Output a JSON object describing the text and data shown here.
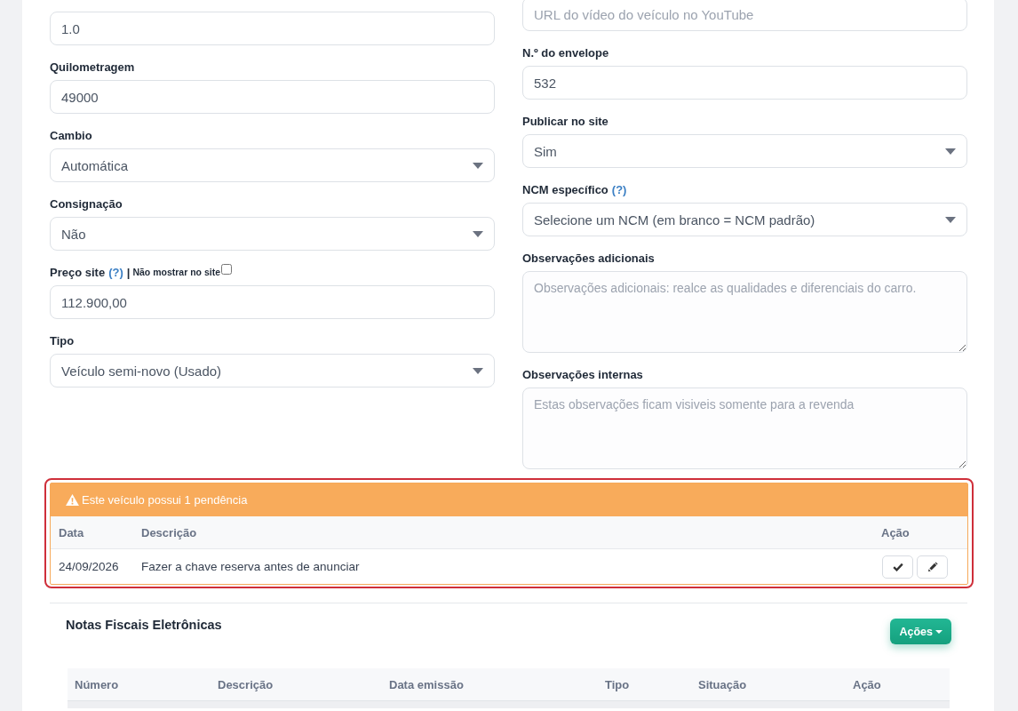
{
  "form": {
    "left_column": [
      {
        "kind": "input",
        "value": "1.0"
      },
      {
        "label": "Quilometragem",
        "kind": "input",
        "value": "49000"
      },
      {
        "label": "Cambio",
        "kind": "select",
        "value": "Automática"
      },
      {
        "label": "Consignação",
        "kind": "select",
        "value": "Não"
      },
      {
        "label": "Preço site",
        "help": "(?)",
        "separator": "|",
        "option": {
          "label": "Não mostrar no site",
          "checked": false
        },
        "kind": "input",
        "value": "112.900,00"
      },
      {
        "label": "Tipo",
        "kind": "select",
        "value": "Veículo semi-novo (Usado)"
      }
    ],
    "right_column": [
      {
        "kind": "input",
        "placeholder": "URL do vídeo do veículo no YouTube"
      },
      {
        "label": "N.º do envelope",
        "kind": "input",
        "value": "532"
      },
      {
        "label": "Publicar no site",
        "kind": "select",
        "value": "Sim"
      },
      {
        "label": "NCM específico",
        "help": "(?)",
        "kind": "select",
        "value": "Selecione um NCM (em branco = NCM padrão)"
      },
      {
        "label": "Observações adicionais",
        "kind": "textarea",
        "placeholder": "Observações adicionais: realce as qualidades e diferenciais do carro."
      },
      {
        "label": "Observações internas",
        "kind": "textarea",
        "placeholder": "Estas observações ficam visiveis somente para a revenda"
      }
    ]
  },
  "pending_alert": {
    "title": "Este veículo possui 1 pendência",
    "columns": [
      "Data",
      "Descrição",
      "Ação"
    ],
    "rows": [
      {
        "date": "24/09/2026",
        "description": "Fazer a chave reserva antes de anunciar"
      }
    ]
  },
  "nfe_section": {
    "title": "Notas Fiscais Eletrônicas",
    "actions_button": "Ações",
    "columns": [
      "Número",
      "Descrição",
      "Data emissão",
      "Tipo",
      "Situação",
      "Ação"
    ]
  }
}
